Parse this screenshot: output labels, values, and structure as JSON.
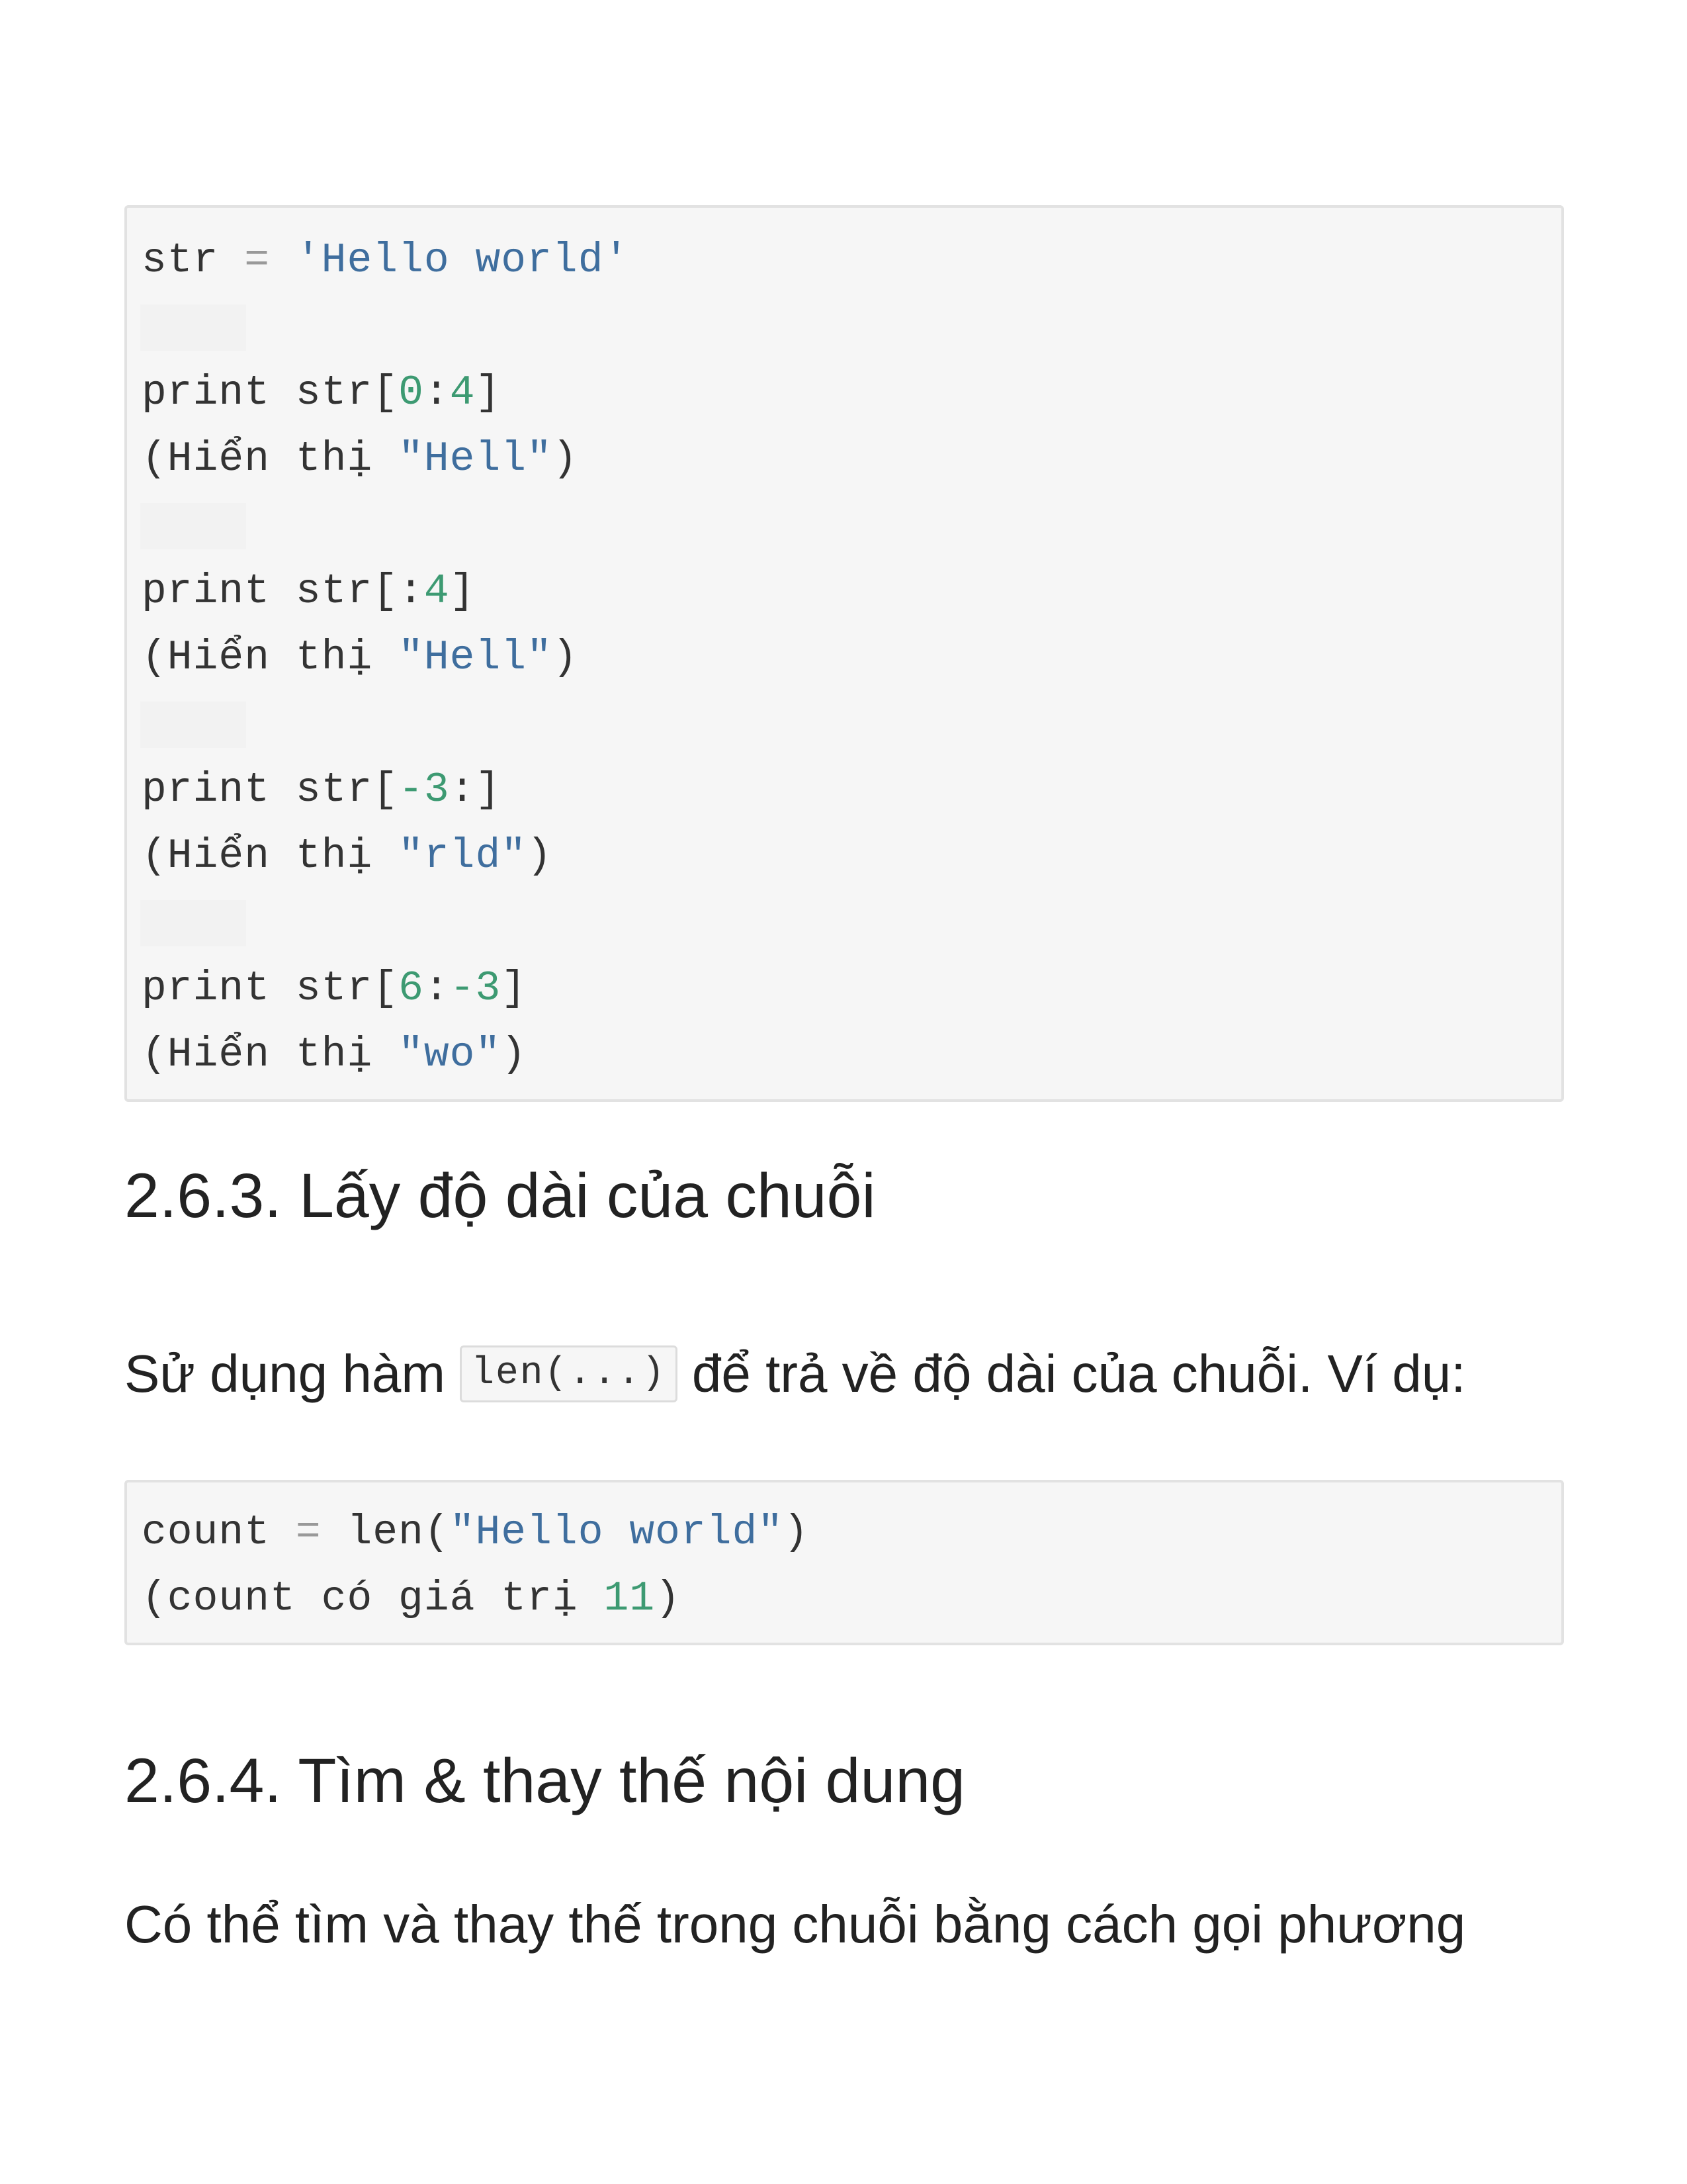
{
  "code_block_1": {
    "lines": [
      {
        "parts": [
          {
            "t": "str ",
            "c": ""
          },
          {
            "t": "=",
            "c": "op"
          },
          {
            "t": " ",
            "c": ""
          },
          {
            "t": "'Hello world'",
            "c": "str"
          }
        ]
      },
      {
        "parts": []
      },
      {
        "parts": [
          {
            "t": "print str[",
            "c": ""
          },
          {
            "t": "0",
            "c": "num"
          },
          {
            "t": ":",
            "c": ""
          },
          {
            "t": "4",
            "c": "num"
          },
          {
            "t": "]",
            "c": ""
          }
        ]
      },
      {
        "parts": [
          {
            "t": "(Hiển thị ",
            "c": ""
          },
          {
            "t": "\"Hell\"",
            "c": "str"
          },
          {
            "t": ")",
            "c": ""
          }
        ]
      },
      {
        "parts": []
      },
      {
        "parts": [
          {
            "t": "print str[:",
            "c": ""
          },
          {
            "t": "4",
            "c": "num"
          },
          {
            "t": "]",
            "c": ""
          }
        ]
      },
      {
        "parts": [
          {
            "t": "(Hiển thị ",
            "c": ""
          },
          {
            "t": "\"Hell\"",
            "c": "str"
          },
          {
            "t": ")",
            "c": ""
          }
        ]
      },
      {
        "parts": []
      },
      {
        "parts": [
          {
            "t": "print str[",
            "c": ""
          },
          {
            "t": "-3",
            "c": "num"
          },
          {
            "t": ":]",
            "c": ""
          }
        ]
      },
      {
        "parts": [
          {
            "t": "(Hiển thị ",
            "c": ""
          },
          {
            "t": "\"rld\"",
            "c": "str"
          },
          {
            "t": ")",
            "c": ""
          }
        ]
      },
      {
        "parts": []
      },
      {
        "parts": [
          {
            "t": "print str[",
            "c": ""
          },
          {
            "t": "6",
            "c": "num"
          },
          {
            "t": ":",
            "c": ""
          },
          {
            "t": "-3",
            "c": "num"
          },
          {
            "t": "]",
            "c": ""
          }
        ]
      },
      {
        "parts": [
          {
            "t": "(Hiển thị ",
            "c": ""
          },
          {
            "t": "\"wo\"",
            "c": "str"
          },
          {
            "t": ")",
            "c": ""
          }
        ]
      }
    ]
  },
  "section_263": {
    "heading": "2.6.3. Lấy độ dài của chuỗi",
    "text_before": "Sử dụng hàm ",
    "inline_code": "len(...)",
    "text_after": " để trả về độ dài của chuỗi. Ví dụ:"
  },
  "code_block_2": {
    "lines": [
      {
        "parts": [
          {
            "t": "count ",
            "c": ""
          },
          {
            "t": "=",
            "c": "op"
          },
          {
            "t": " len(",
            "c": ""
          },
          {
            "t": "\"Hello world\"",
            "c": "str"
          },
          {
            "t": ")",
            "c": ""
          }
        ]
      },
      {
        "parts": [
          {
            "t": "(count có giá trị ",
            "c": ""
          },
          {
            "t": "11",
            "c": "num"
          },
          {
            "t": ")",
            "c": ""
          }
        ]
      }
    ]
  },
  "section_264": {
    "heading": "2.6.4. Tìm & thay thế nội dung",
    "paragraph": "Có thể tìm và thay thế trong chuỗi bằng cách gọi phương"
  }
}
